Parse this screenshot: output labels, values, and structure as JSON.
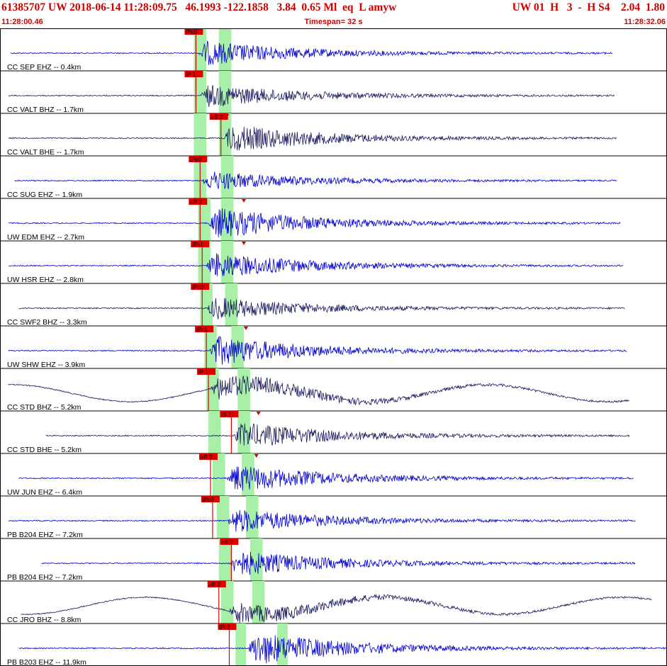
{
  "header": {
    "title": "61385707 UW 2018-06-14 11:28:09.75   46.1993 -122.1858   3.84  0.65 Ml  eq  L amyw",
    "stats": "UW 01  H   3  -  H S4    2.04  1.80",
    "start_time": "11:28:00.46",
    "end_time": "11:28:32.06",
    "timespan": "Timespan=  32 s"
  },
  "colors": {
    "title_red": "#d00000",
    "pick_red": "#e00000",
    "window_green": "#a8f0a8",
    "trace_blue": "#0000cc",
    "trace_navy": "#1a1a5e"
  },
  "chart_data": {
    "type": "seismogram",
    "time_range_s": [
      0,
      32
    ],
    "start_time": "11:28:00.46",
    "end_time": "11:28:32.06",
    "traces": [
      {
        "label": "CC SEP EHZ -- 0.4km",
        "pick": "iPc0",
        "pick_t": 9.4,
        "s_marker_t": null,
        "windows": [
          [
            9.3,
            9.9
          ],
          [
            10.5,
            11.1
          ]
        ],
        "color": "blue",
        "onset_t": 9.5,
        "end_t": 29.4,
        "amp": 0.7,
        "wave": false
      },
      {
        "label": "CC VALT BHZ -- 1.7km",
        "pick": "iP 1",
        "pick_t": 9.4,
        "s_marker_t": null,
        "windows": [
          [
            9.3,
            9.9
          ],
          [
            10.5,
            11.1
          ]
        ],
        "color": "navy",
        "onset_t": 9.6,
        "end_t": 29.5,
        "amp": 0.65,
        "wave": false
      },
      {
        "label": "CC VALT BHE -- 1.7km",
        "pick": "eS 2",
        "pick_t": 10.6,
        "s_marker_t": 10.9,
        "windows": [
          [
            9.3,
            9.9
          ],
          [
            10.5,
            11.1
          ]
        ],
        "color": "navy",
        "onset_t": 10.7,
        "end_t": 29.6,
        "amp": 0.8,
        "wave": false
      },
      {
        "label": "CC SUG EHZ -- 1.9km",
        "pick": "iPc0",
        "pick_t": 9.6,
        "s_marker_t": null,
        "windows": [
          [
            9.3,
            9.9
          ],
          [
            10.6,
            11.2
          ]
        ],
        "color": "blue",
        "onset_t": 9.7,
        "end_t": 29.6,
        "amp": 0.55,
        "wave": false
      },
      {
        "label": "UW EDM EHZ -- 2.7km",
        "pick": "eP 2",
        "pick_t": 9.6,
        "s_marker_t": 11.7,
        "windows": [
          [
            9.5,
            10.1
          ],
          [
            10.6,
            11.2
          ]
        ],
        "color": "blue",
        "onset_t": 10.0,
        "end_t": 29.8,
        "amp": 0.9,
        "wave": false
      },
      {
        "label": "UW HSR EHZ -- 2.8km",
        "pick": "iPs1",
        "pick_t": 9.7,
        "s_marker_t": 11.7,
        "windows": [
          [
            9.5,
            10.1
          ],
          [
            10.6,
            11.2
          ]
        ],
        "color": "blue",
        "onset_t": 9.9,
        "end_t": 29.9,
        "amp": 0.75,
        "wave": false
      },
      {
        "label": "CC SWF2 BHZ -- 3.3km",
        "pick": "iPc0",
        "pick_t": 9.7,
        "s_marker_t": null,
        "windows": [
          [
            9.6,
            10.2
          ],
          [
            10.8,
            11.4
          ]
        ],
        "color": "navy",
        "onset_t": 9.9,
        "end_t": 30.0,
        "amp": 0.65,
        "wave": false
      },
      {
        "label": "UW SHW EHZ -- 3.9km",
        "pick": "iPc1",
        "pick_t": 9.9,
        "s_marker_t": 11.8,
        "windows": [
          [
            9.8,
            10.4
          ],
          [
            11.1,
            11.7
          ]
        ],
        "color": "blue",
        "onset_t": 10.0,
        "end_t": 30.1,
        "amp": 0.85,
        "wave": false
      },
      {
        "label": "CC STD BHZ -- 5.2km",
        "pick": "iP 1",
        "pick_t": 10.0,
        "s_marker_t": null,
        "windows": [
          [
            9.9,
            10.5
          ],
          [
            11.4,
            12.0
          ]
        ],
        "color": "navy",
        "onset_t": 10.1,
        "end_t": 30.2,
        "amp": 0.7,
        "wave": true
      },
      {
        "label": "CC STD BHE -- 5.2km",
        "pick": "iS 1",
        "pick_t": 11.1,
        "s_marker_t": 12.4,
        "windows": [
          [
            10.0,
            10.6
          ],
          [
            11.4,
            12.0
          ]
        ],
        "color": "navy",
        "onset_t": 11.2,
        "end_t": 30.2,
        "amp": 0.75,
        "wave": false
      },
      {
        "label": "UW JUN EHZ -- 6.4km",
        "pick": "eP 2",
        "pick_t": 10.1,
        "s_marker_t": 12.3,
        "windows": [
          [
            10.2,
            10.8
          ],
          [
            11.6,
            12.2
          ]
        ],
        "color": "blue",
        "onset_t": 10.9,
        "end_t": 30.4,
        "amp": 0.8,
        "wave": false
      },
      {
        "label": "PB B204 EHZ -- 7.2km",
        "pick": "iPc0",
        "pick_t": 10.2,
        "s_marker_t": null,
        "windows": [
          [
            10.4,
            11.0
          ],
          [
            11.8,
            12.4
          ]
        ],
        "color": "blue",
        "onset_t": 10.9,
        "end_t": 30.5,
        "amp": 0.7,
        "wave": false
      },
      {
        "label": "PB B204 EH2 -- 7.2km",
        "pick": "eS 2",
        "pick_t": 11.1,
        "s_marker_t": null,
        "windows": [
          [
            10.5,
            11.1
          ],
          [
            12.0,
            12.6
          ]
        ],
        "color": "blue",
        "onset_t": 11.0,
        "end_t": 30.5,
        "amp": 0.75,
        "wave": false
      },
      {
        "label": "CC JRO BHZ -- 8.8km",
        "pick": "eP 2",
        "pick_t": 10.5,
        "s_marker_t": null,
        "windows": [
          [
            10.6,
            11.2
          ],
          [
            12.1,
            12.7
          ]
        ],
        "color": "navy",
        "onset_t": 11.0,
        "end_t": 31.3,
        "amp": 0.6,
        "wave": true
      },
      {
        "label": "PB B203 EHZ -- 11.9km",
        "pick": "iPc1",
        "pick_t": 11.0,
        "s_marker_t": null,
        "windows": [
          [
            11.3,
            11.8
          ],
          [
            13.3,
            13.8
          ]
        ],
        "color": "blue",
        "onset_t": 11.9,
        "end_t": 32.0,
        "amp": 0.95,
        "wave": false
      }
    ]
  }
}
